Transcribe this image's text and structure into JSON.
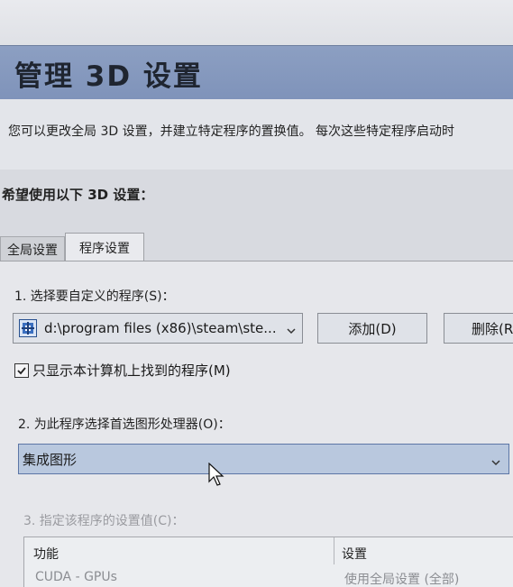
{
  "window": {
    "title": "管理 3D 设置"
  },
  "description": "您可以更改全局 3D 设置，并建立特定程序的置换值。 每次这些特定程序启动时",
  "section_title": "希望使用以下 3D 设置：",
  "tabs": [
    {
      "label": "全局设置",
      "active": false
    },
    {
      "label": "程序设置",
      "active": true
    }
  ],
  "step1": {
    "label": "1. 选择要自定义的程序(S)：",
    "program_value": "d:\\program files (x86)\\steam\\ste...",
    "add_button": "添加(D)",
    "remove_button": "删除(R"
  },
  "checkbox": {
    "label": "只显示本计算机上找到的程序(M)",
    "checked": true
  },
  "step2": {
    "label": "2. 为此程序选择首选图形处理器(O)：",
    "selected_value": "集成图形"
  },
  "step3": {
    "label": "3. 指定该程序的设置值(C)：",
    "enabled": false,
    "columns": [
      "功能",
      "设置"
    ],
    "rows": [
      {
        "feature": "CUDA - GPUs",
        "setting": "使用全局设置 (全部)"
      }
    ]
  },
  "icons": {
    "program": "program-icon",
    "dropdown": "chevron-down-icon",
    "checkbox": "checkmark-icon",
    "cursor": "mouse-pointer-icon"
  },
  "colors": {
    "header": "#8093ba",
    "selected_field": "#b9c8de",
    "disabled_text": "#9a9ba0"
  }
}
